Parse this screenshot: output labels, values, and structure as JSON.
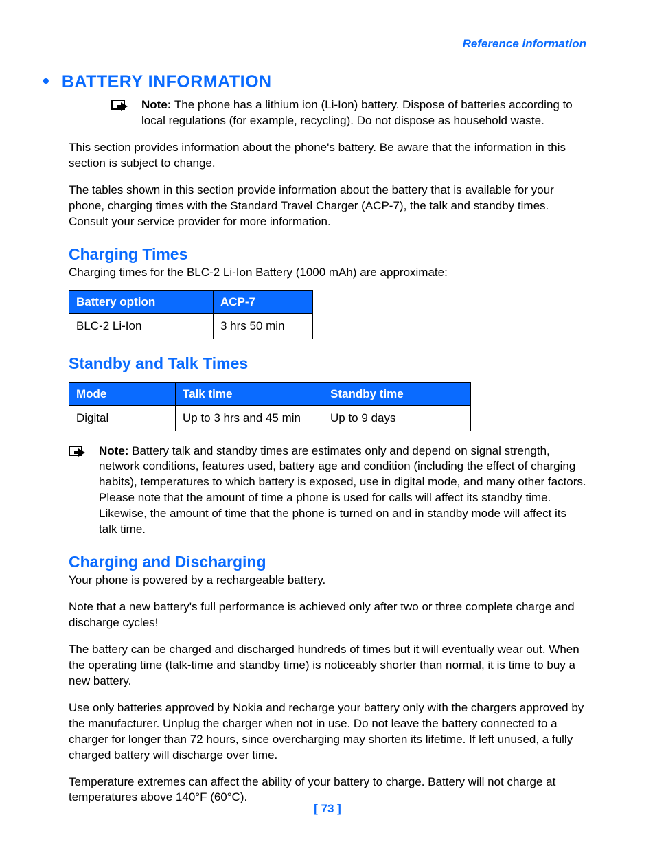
{
  "header": {
    "link": "Reference information"
  },
  "section": {
    "title": "BATTERY INFORMATION",
    "note1_label": "Note:",
    "note1_text": " The phone has a lithium ion (Li-Ion) battery. Dispose of batteries according to local regulations (for example, recycling). Do not dispose as household waste.",
    "para1": "This section provides information about the phone's battery. Be aware that the information in this section is subject to change.",
    "para2": "The tables shown in this section provide information about the battery that is available for your phone, charging times with the Standard Travel Charger (ACP-7), the talk and standby times. Consult your service provider for more information."
  },
  "charging_times": {
    "heading": "Charging Times",
    "intro": "Charging times for the BLC-2 Li-Ion Battery (1000 mAh) are approximate:",
    "headers": [
      "Battery option",
      "ACP-7"
    ],
    "row": [
      "BLC-2 Li-Ion",
      "3 hrs 50 min"
    ]
  },
  "standby_talk": {
    "heading": "Standby and Talk Times",
    "headers": [
      "Mode",
      "Talk time",
      "Standby time"
    ],
    "row": [
      "Digital",
      "Up to 3 hrs and 45 min",
      "Up to 9 days"
    ],
    "note_label": "Note:",
    "note_text": " Battery talk and standby times are estimates only and depend on signal strength, network conditions, features used, battery age and condition (including the effect of charging habits), temperatures to which battery is exposed, use in digital mode, and many other factors. Please note that the amount of time a phone is used for calls will affect its standby time. Likewise, the amount of time that the phone is turned on and in standby mode will affect its talk time."
  },
  "charging_discharging": {
    "heading": "Charging and Discharging",
    "p1": "Your phone is powered by a rechargeable battery.",
    "p2": "Note that a new battery's full performance is achieved only after two or three complete charge and discharge cycles!",
    "p3": "The battery can be charged and discharged hundreds of times but it will eventually wear out. When the operating time (talk-time and standby time) is noticeably shorter than normal, it is time to buy a new battery.",
    "p4": "Use only batteries approved by Nokia and recharge your battery only with the chargers approved by the manufacturer. Unplug the charger when not in use. Do not leave the battery connected to a charger for longer than 72 hours, since overcharging may shorten its lifetime. If left unused, a fully charged battery will discharge over time.",
    "p5": "Temperature extremes can affect the ability of your battery to charge. Battery will not charge at temperatures above 140°F (60°C)."
  },
  "footer": {
    "page": "[ 73 ]"
  }
}
